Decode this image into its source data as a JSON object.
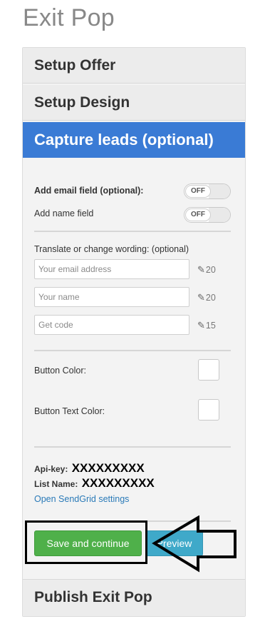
{
  "page": {
    "title": "Exit Pop"
  },
  "sections": {
    "setup_offer": "Setup Offer",
    "setup_design": "Setup Design",
    "capture_leads": "Capture leads (optional)",
    "publish": "Publish Exit Pop"
  },
  "fields": {
    "email_toggle_label": "Add email field (optional):",
    "email_toggle_state": "OFF",
    "name_toggle_label": "Add name field",
    "name_toggle_state": "OFF",
    "translate_label": "Translate or change wording: (optional)",
    "email_placeholder": "Your email address",
    "email_count": "20",
    "name_placeholder": "Your name",
    "name_count": "20",
    "code_placeholder": "Get code",
    "code_count": "15"
  },
  "colors": {
    "button_color_label": "Button Color:",
    "button_text_color_label": "Button Text Color:",
    "button_color_value": "#ffffff",
    "button_text_color_value": "#ffffff"
  },
  "sendgrid": {
    "api_key_label": "Api-key:",
    "api_key_value": "XXXXXXXXX",
    "list_name_label": "List Name:",
    "list_name_value": "XXXXXXXXX",
    "settings_link": "Open SendGrid settings"
  },
  "actions": {
    "save_label": "Save and continue",
    "preview_label": "Preview"
  },
  "theme": {
    "active_section": "#3a7bd5",
    "save_button": "#4fb04a",
    "preview_button": "#3fa9c9",
    "link": "#2a7ab8"
  }
}
